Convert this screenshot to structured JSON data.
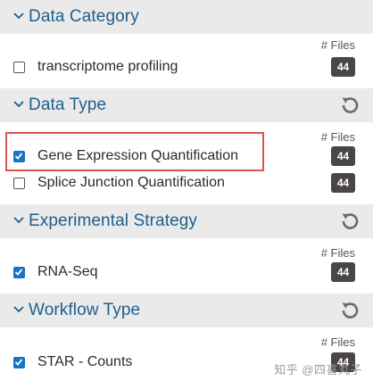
{
  "files_label": "# Files",
  "sections": [
    {
      "title": "Data Category",
      "has_reset": false,
      "items": [
        {
          "label": "transcriptome profiling",
          "checked": false,
          "count": "44"
        }
      ]
    },
    {
      "title": "Data Type",
      "has_reset": true,
      "items": [
        {
          "label": "Gene Expression Quantification",
          "checked": true,
          "count": "44",
          "highlighted": true
        },
        {
          "label": "Splice Junction Quantification",
          "checked": false,
          "count": "44"
        }
      ]
    },
    {
      "title": "Experimental Strategy",
      "has_reset": true,
      "items": [
        {
          "label": "RNA-Seq",
          "checked": true,
          "count": "44"
        }
      ]
    },
    {
      "title": "Workflow Type",
      "has_reset": true,
      "items": [
        {
          "label": "STAR - Counts",
          "checked": true,
          "count": "44"
        }
      ]
    }
  ],
  "watermark": "知乎 @四喜丸子",
  "colors": {
    "header_bg": "#eaeaea",
    "title": "#1f5f8b",
    "checkbox_checked": "#1a73c7",
    "badge_bg": "#4a4646",
    "highlight_border": "#d9534f"
  }
}
